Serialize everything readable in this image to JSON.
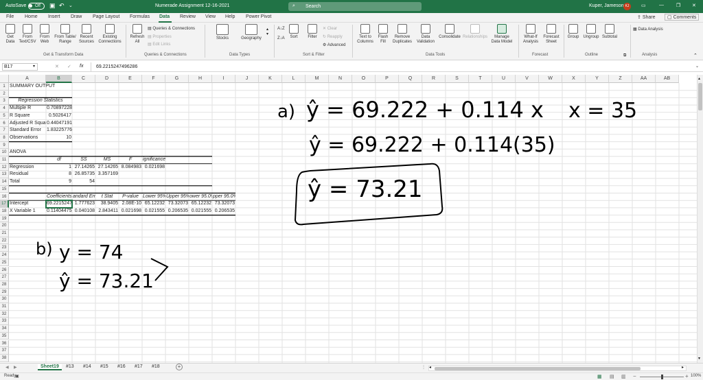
{
  "titlebar": {
    "autosave_label": "AutoSave",
    "autosave_state": "Off",
    "doc_title": "Numerade Assignment 12-16-2021",
    "search_placeholder": "Search",
    "user_name": "Kuper, Jameson",
    "user_initials": "KJ"
  },
  "ribbon_tabs": [
    "File",
    "Home",
    "Insert",
    "Draw",
    "Page Layout",
    "Formulas",
    "Data",
    "Review",
    "View",
    "Help",
    "Power Pivot"
  ],
  "active_tab": "Data",
  "share_label": "Share",
  "comments_label": "Comments",
  "ribbon": {
    "get_data": "Get\nData",
    "from_text_csv": "From\nText/CSV",
    "from_web": "From\nWeb",
    "from_table_range": "From Table/\nRange",
    "recent_sources": "Recent\nSources",
    "existing_connections": "Existing\nConnections",
    "group_get_transform": "Get & Transform Data",
    "refresh_all": "Refresh\nAll",
    "queries_connections": "Queries & Connections",
    "properties": "Properties",
    "edit_links": "Edit Links",
    "group_queries": "Queries & Connections",
    "stocks": "Stocks",
    "geography": "Geography",
    "group_data_types": "Data Types",
    "sort": "Sort",
    "filter": "Filter",
    "clear": "Clear",
    "reapply": "Reapply",
    "advanced": "Advanced",
    "group_sort_filter": "Sort & Filter",
    "text_to_columns": "Text to\nColumns",
    "flash_fill": "Flash\nFill",
    "remove_duplicates": "Remove\nDuplicates",
    "data_validation": "Data\nValidation",
    "consolidate": "Consolidate",
    "relationships": "Relationships",
    "manage_data_model": "Manage\nData Model",
    "group_data_tools": "Data Tools",
    "what_if": "What-If\nAnalysis",
    "forecast_sheet": "Forecast\nSheet",
    "group_forecast": "Forecast",
    "group_btn": "Group",
    "ungroup": "Ungroup",
    "subtotal": "Subtotal",
    "group_outline": "Outline",
    "data_analysis": "Data Analysis",
    "group_analysis": "Analysis"
  },
  "formula_bar": {
    "name_box": "B17",
    "fx": "fx",
    "formula": "69.2215247496286"
  },
  "columns": [
    "A",
    "B",
    "C",
    "D",
    "E",
    "F",
    "G",
    "H",
    "I",
    "J",
    "K",
    "L",
    "M",
    "N",
    "O",
    "P",
    "Q",
    "R",
    "S",
    "T",
    "U",
    "V",
    "W",
    "X",
    "Y",
    "Z",
    "AA",
    "AB"
  ],
  "rows": [
    "1",
    "2",
    "3",
    "4",
    "5",
    "6",
    "7",
    "8",
    "9",
    "10",
    "11",
    "12",
    "13",
    "14",
    "15",
    "16",
    "17",
    "18",
    "19",
    "20",
    "21",
    "22",
    "23",
    "24",
    "25",
    "26",
    "27",
    "28",
    "29",
    "30",
    "31",
    "32",
    "33",
    "34",
    "35",
    "36",
    "37",
    "38"
  ],
  "cells": {
    "a1": "SUMMARY OUTPUT",
    "a3": "Regression Statistics",
    "a4": "Multiple R",
    "b4": "0.708972284",
    "a5": "R Square",
    "b5": "0.5026417",
    "a6": "Adjusted R Square",
    "b6": "0.440471912",
    "a7": "Standard Error",
    "b7": "1.832257768",
    "a8": "Observations",
    "b8": "10",
    "a10": "ANOVA",
    "b11": "df",
    "c11": "SS",
    "d11": "MS",
    "e11": "F",
    "f11": "ignificance F",
    "a12": "Regression",
    "b12": "1",
    "c12": "27.14265",
    "d12": "27.14265",
    "e12": "8.084983",
    "f12": "0.021698",
    "a13": "Residual",
    "b13": "8",
    "c13": "26.85735",
    "d13": "3.357169",
    "a14": "Total",
    "b14": "9",
    "c14": "54",
    "b16": "Coefficients",
    "c16": "andard Err",
    "d16": "t Stat",
    "e16": "P-value",
    "f16": "Lower 95%",
    "g16": "Upper 95%",
    "h16": "ower 95.0%",
    "i16": "pper 95.0%",
    "a17": "Intercept",
    "b17": "69.22152475",
    "c17": "1.777623",
    "d17": "38.9405",
    "e17": "2.08E-10",
    "f17": "65.12232",
    "g17": "73.32073",
    "h17": "65.12232",
    "i17": "73.32073",
    "a18": "X Variable 1",
    "b18": "0.114044755",
    "c18": "0.040108",
    "d18": "2.843411",
    "e18": "0.021698",
    "f18": "0.021555",
    "g18": "0.206535",
    "h18": "0.021555",
    "i18": "0.206535"
  },
  "handwriting": {
    "a_label": "a)",
    "line1": "ŷ = 69.222 + 0.114 x",
    "x_given": "x = 35",
    "line2": "ŷ = 69.222 + 0.114(35)",
    "line3": "ŷ = 73.21",
    "b_label": "b)",
    "line4": "y = 74",
    "line5": "ŷ = 73.21"
  },
  "sheet_tabs": [
    "Sheet19",
    "#13",
    "#14",
    "#15",
    "#16",
    "#17",
    "#18"
  ],
  "active_sheet": "Sheet19",
  "status": {
    "ready": "Ready",
    "zoom": "100%"
  },
  "colors": {
    "excel_green": "#217346",
    "ink": "#000000"
  }
}
